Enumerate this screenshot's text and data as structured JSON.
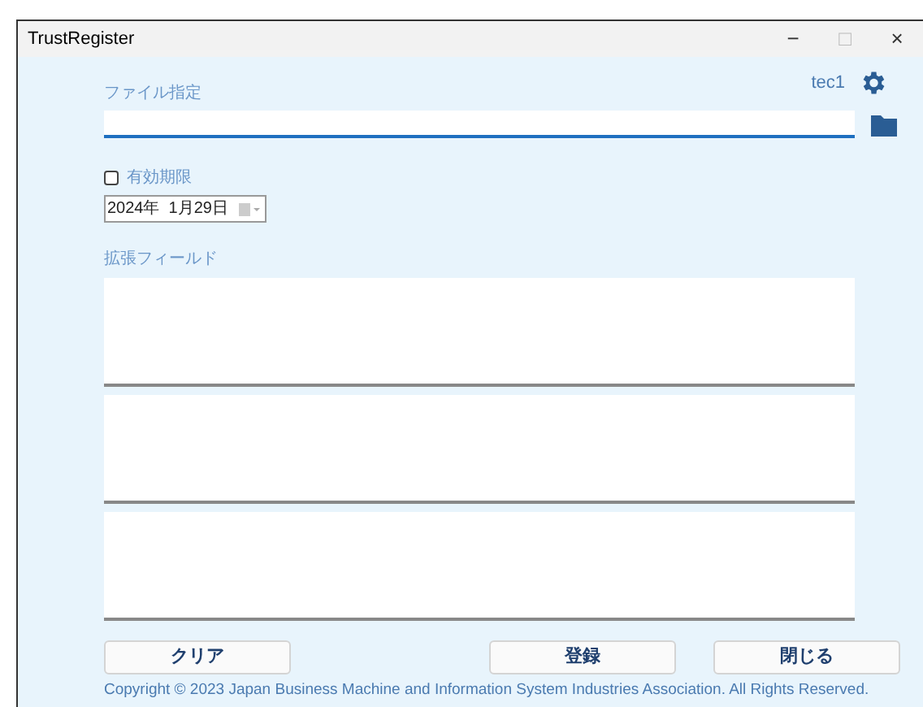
{
  "window": {
    "title": "TrustRegister",
    "controls": [
      "−",
      "□",
      "×"
    ]
  },
  "user": "tec1",
  "file_field": {
    "label": "ファイル指定"
  },
  "expiry": {
    "label": "有効期限",
    "checked": false,
    "date": "2024年  1月29日"
  },
  "extension": {
    "label": "拡張フィールド"
  },
  "left_buttons": [
    "クリア"
  ],
  "right_buttons": [
    "登録",
    "閉じる"
  ],
  "copyright": "Copyright © 2023 Japan Business Machine and Information System Industries Association. All Rights Reserved."
}
